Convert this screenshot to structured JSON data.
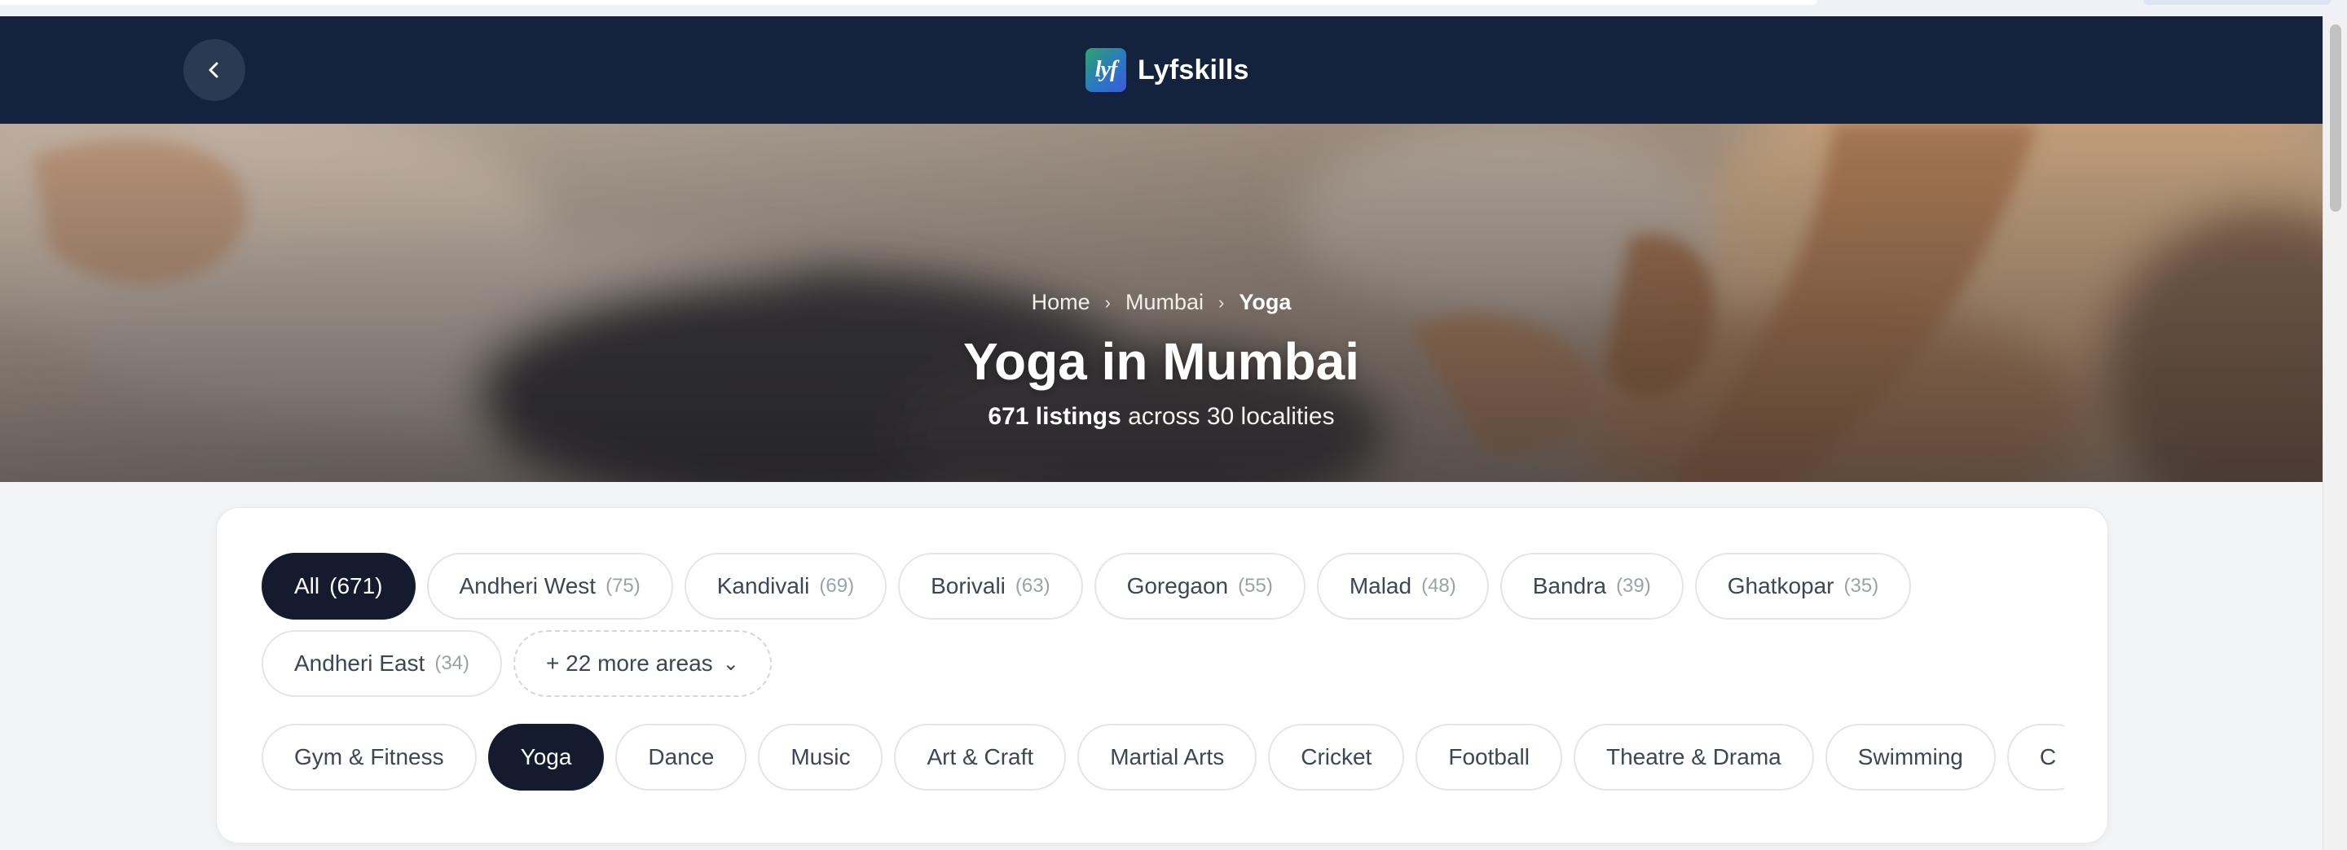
{
  "header": {
    "brand_mark": "lyf",
    "brand_name": "Lyfskills"
  },
  "hero": {
    "breadcrumb": {
      "home": "Home",
      "city": "Mumbai",
      "current": "Yoga",
      "separator": "›"
    },
    "title": "Yoga in Mumbai",
    "listings_strong": "671 listings",
    "listings_rest": "across 30 localities"
  },
  "areas": [
    {
      "label": "All",
      "count": "(671)",
      "active": true
    },
    {
      "label": "Andheri West",
      "count": "(75)"
    },
    {
      "label": "Kandivali",
      "count": "(69)"
    },
    {
      "label": "Borivali",
      "count": "(63)"
    },
    {
      "label": "Goregaon",
      "count": "(55)"
    },
    {
      "label": "Malad",
      "count": "(48)"
    },
    {
      "label": "Bandra",
      "count": "(39)"
    },
    {
      "label": "Ghatkopar",
      "count": "(35)"
    },
    {
      "label": "Andheri East",
      "count": "(34)"
    }
  ],
  "more_areas": {
    "label": "+ 22 more areas",
    "chevron": "⌄"
  },
  "categories": [
    {
      "label": "Gym & Fitness"
    },
    {
      "label": "Yoga",
      "active": true
    },
    {
      "label": "Dance"
    },
    {
      "label": "Music"
    },
    {
      "label": "Art & Craft"
    },
    {
      "label": "Martial Arts"
    },
    {
      "label": "Cricket"
    },
    {
      "label": "Football"
    },
    {
      "label": "Theatre & Drama"
    },
    {
      "label": "Swimming"
    },
    {
      "label": "C"
    }
  ],
  "colors": {
    "header_bg": "#13233d",
    "active_chip": "#151b2e",
    "page_bg": "#f3f4f6"
  },
  "icons": {
    "back": "chevron-left-icon",
    "breadcrumb_sep": "chevron-right-icon",
    "more": "chevron-down-icon"
  }
}
